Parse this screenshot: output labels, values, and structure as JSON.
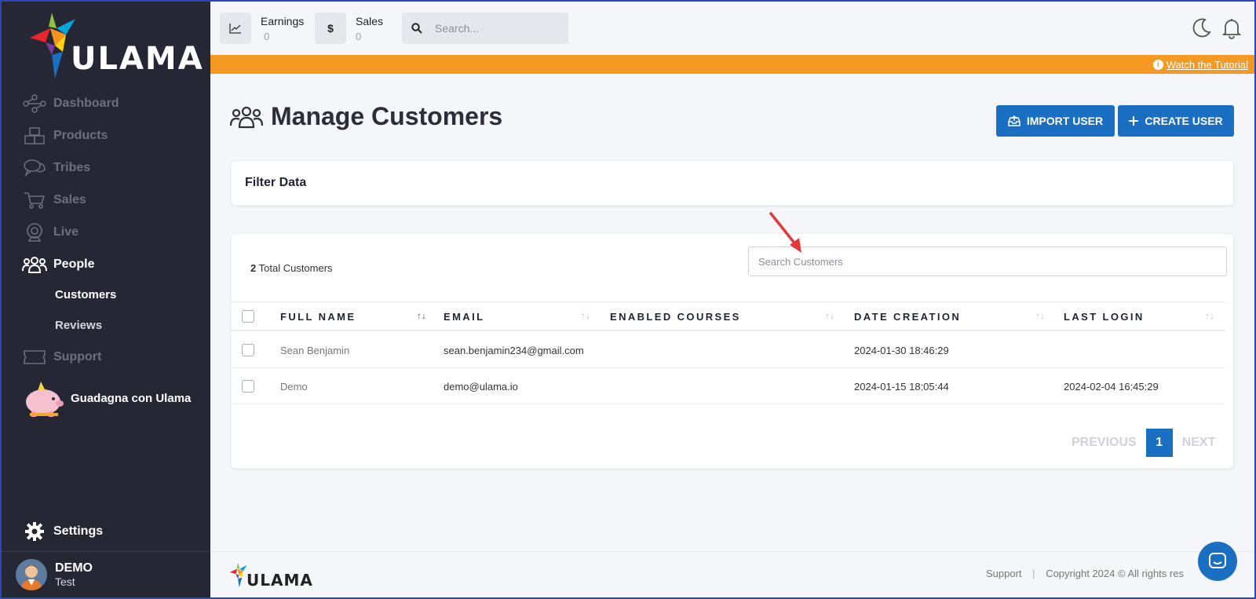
{
  "brand": {
    "name": "ULAMA"
  },
  "sidebar": {
    "items": [
      {
        "label": "Dashboard",
        "icon": "network-icon"
      },
      {
        "label": "Products",
        "icon": "boxes-icon"
      },
      {
        "label": "Tribes",
        "icon": "chat-bubbles-icon"
      },
      {
        "label": "Sales",
        "icon": "cart-icon"
      },
      {
        "label": "Live",
        "icon": "webcam-icon"
      },
      {
        "label": "People",
        "icon": "users-icon"
      }
    ],
    "sub_items": [
      "Customers",
      "Reviews"
    ],
    "support": "Support",
    "promo": "Guadagna con Ulama",
    "settings": "Settings",
    "user": {
      "name": "DEMO",
      "role": "Test"
    }
  },
  "header": {
    "earnings": {
      "label": "Earnings",
      "value": "0"
    },
    "sales": {
      "label": "Sales",
      "value": "0",
      "icon_glyph": "$"
    },
    "search_placeholder": "Search...",
    "tutorial_link": "Watch the Tutorial"
  },
  "main": {
    "title": "Manage Customers",
    "import_button": "IMPORT USER",
    "create_button": "CREATE USER",
    "filter_title": "Filter Data",
    "total_count": "2",
    "total_label": "Total Customers",
    "search_placeholder": "Search Customers",
    "columns": [
      "FULL NAME",
      "EMAIL",
      "ENABLED COURSES",
      "DATE CREATION",
      "LAST LOGIN"
    ],
    "rows": [
      {
        "name": "Sean Benjamin",
        "email": "sean.benjamin234@gmail.com",
        "courses": "",
        "created": "2024-01-30 18:46:29",
        "last_login": ""
      },
      {
        "name": "Demo",
        "email": "demo@ulama.io",
        "courses": "",
        "created": "2024-01-15 18:05:44",
        "last_login": "2024-02-04 16:45:29"
      }
    ],
    "pager": {
      "previous": "PREVIOUS",
      "current": "1",
      "next": "NEXT"
    }
  },
  "footer": {
    "support": "Support",
    "separator": "|",
    "copyright": "Copyright 2024 © All rights res"
  },
  "colors": {
    "sidebar": "#252834",
    "accent": "#1a6fc2",
    "banner": "#f49a22"
  }
}
